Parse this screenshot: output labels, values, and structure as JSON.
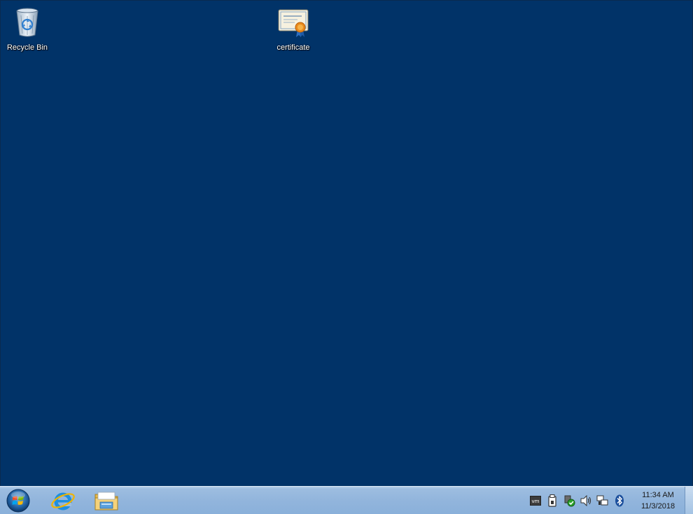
{
  "desktop": {
    "background_color": "#013368",
    "icons": [
      {
        "label": "Recycle Bin",
        "icon": "recycle-bin-icon"
      },
      {
        "label": "certificate",
        "icon": "certificate-icon"
      }
    ]
  },
  "taskbar": {
    "start": {
      "icon": "windows-orb-icon"
    },
    "pinned": [
      {
        "icon": "internet-explorer-icon"
      },
      {
        "icon": "file-explorer-icon"
      }
    ],
    "tray": [
      {
        "icon": "vmware-tools-icon"
      },
      {
        "icon": "usb-device-icon"
      },
      {
        "icon": "action-center-flag-icon"
      },
      {
        "icon": "volume-icon"
      },
      {
        "icon": "network-icon"
      },
      {
        "icon": "bluetooth-icon"
      }
    ],
    "clock": {
      "time": "11:34 AM",
      "date": "11/3/2018"
    }
  }
}
